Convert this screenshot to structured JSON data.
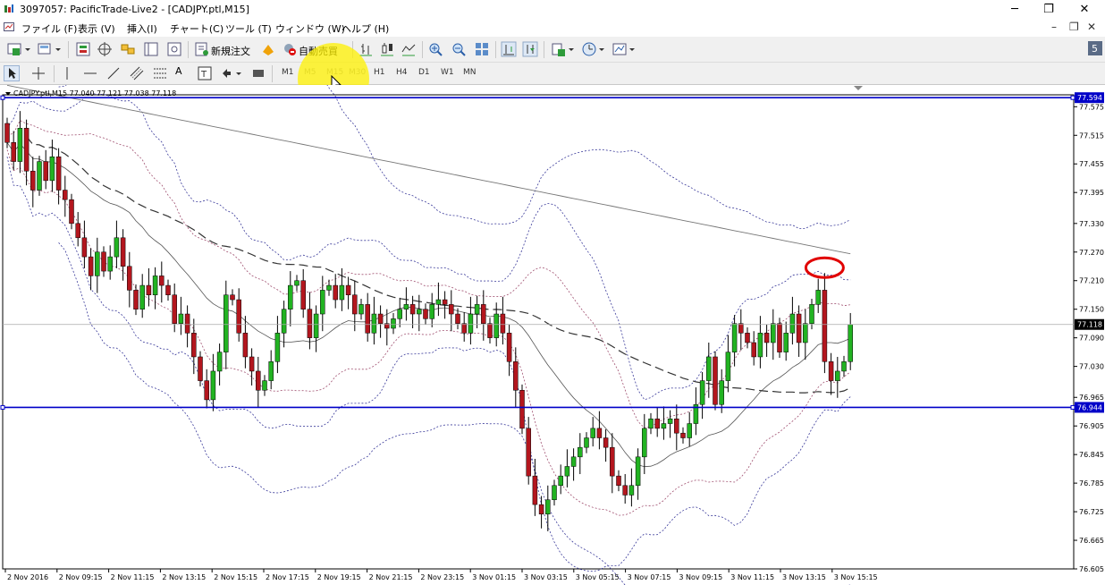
{
  "window": {
    "title": "3097057: PacificTrade-Live2 - [CADJPY.ptl,M15]",
    "minimize": "─",
    "maximize": "❐",
    "close": "✕"
  },
  "menu": {
    "items": [
      "ファイル (F)",
      "表示 (V)",
      "挿入(I)",
      "チャート(C)",
      "ツール (T)",
      "ウィンドウ (W)",
      "ヘルプ (H)"
    ],
    "mdi_minimize": "–",
    "mdi_restore": "❐",
    "mdi_close": "✕"
  },
  "toolbar1": {
    "new_order": "新規注文",
    "auto_trade": "自動売買"
  },
  "toolbar2": {
    "timeframes": [
      "M1",
      "M5",
      "M15",
      "M30",
      "H1",
      "H4",
      "D1",
      "W1",
      "MN"
    ],
    "dim_timeframes": [
      "M5",
      "M15",
      "M30"
    ],
    "text_tool": "A"
  },
  "chart": {
    "symbol_label": "CADJPY.ptl,M15  77.040 77.121 77.038 77.118",
    "price_labels": [
      "77.575",
      "77.515",
      "77.455",
      "77.395",
      "77.330",
      "77.270",
      "77.210",
      "77.150",
      "77.090",
      "77.030",
      "76.965",
      "76.905",
      "76.845",
      "76.785",
      "76.725",
      "76.665",
      "76.605"
    ],
    "time_labels": [
      "2 Nov 2016",
      "2 Nov 09:15",
      "2 Nov 11:15",
      "2 Nov 13:15",
      "2 Nov 15:15",
      "2 Nov 17:15",
      "2 Nov 19:15",
      "2 Nov 21:15",
      "2 Nov 23:15",
      "3 Nov 01:15",
      "3 Nov 03:15",
      "3 Nov 05:15",
      "3 Nov 07:15",
      "3 Nov 09:15",
      "3 Nov 11:15",
      "3 Nov 13:15",
      "3 Nov 15:15"
    ],
    "upper_line_label": "77.594",
    "lower_line_label": "76.944",
    "current_price_label": "77.118",
    "colors": {
      "bull": "#22b322",
      "bear": "#b3161e",
      "hline": "#0000c8",
      "ma": "#555555",
      "band_outer": "#3a3a9a",
      "band_inner": "#a05070",
      "marker": "#e10000"
    }
  },
  "chart_data": {
    "type": "candlestick",
    "symbol": "CADJPY.ptl",
    "timeframe": "M15",
    "ohlc_header": {
      "open": 77.04,
      "high": 77.121,
      "low": 77.038,
      "close": 77.118
    },
    "ylim": [
      76.605,
      77.6
    ],
    "horizontal_lines": [
      77.594,
      76.944
    ],
    "current_price": 77.118,
    "closes": [
      77.5,
      77.46,
      77.53,
      77.44,
      77.4,
      77.46,
      77.42,
      77.47,
      77.4,
      77.38,
      77.33,
      77.3,
      77.26,
      77.22,
      77.27,
      77.23,
      77.26,
      77.3,
      77.24,
      77.19,
      77.15,
      77.2,
      77.18,
      77.22,
      77.2,
      77.18,
      77.12,
      77.14,
      77.1,
      77.05,
      77.0,
      76.96,
      77.02,
      77.06,
      77.18,
      77.17,
      77.1,
      77.05,
      77.02,
      76.98,
      77.0,
      77.04,
      77.1,
      77.15,
      77.2,
      77.21,
      77.15,
      77.09,
      77.14,
      77.19,
      77.2,
      77.17,
      77.2,
      77.18,
      77.14,
      77.16,
      77.1,
      77.14,
      77.12,
      77.11,
      77.13,
      77.15,
      77.16,
      77.14,
      77.15,
      77.13,
      77.16,
      77.17,
      77.16,
      77.14,
      77.12,
      77.1,
      77.14,
      77.16,
      77.12,
      77.09,
      77.14,
      77.1,
      77.04,
      76.98,
      76.9,
      76.8,
      76.74,
      76.72,
      76.75,
      76.78,
      76.8,
      76.82,
      76.84,
      76.86,
      76.88,
      76.9,
      76.88,
      76.86,
      76.8,
      76.78,
      76.76,
      76.78,
      76.84,
      76.9,
      76.92,
      76.9,
      76.91,
      76.92,
      76.89,
      76.88,
      76.91,
      76.95,
      77.0,
      77.05,
      76.95,
      77.0,
      77.06,
      77.12,
      77.1,
      77.08,
      77.05,
      77.1,
      77.08,
      77.12,
      77.06,
      77.1,
      77.14,
      77.08,
      77.12,
      77.16,
      77.19,
      77.04,
      77.0,
      77.02,
      77.04,
      77.118
    ],
    "xlabel": "",
    "ylabel": ""
  }
}
